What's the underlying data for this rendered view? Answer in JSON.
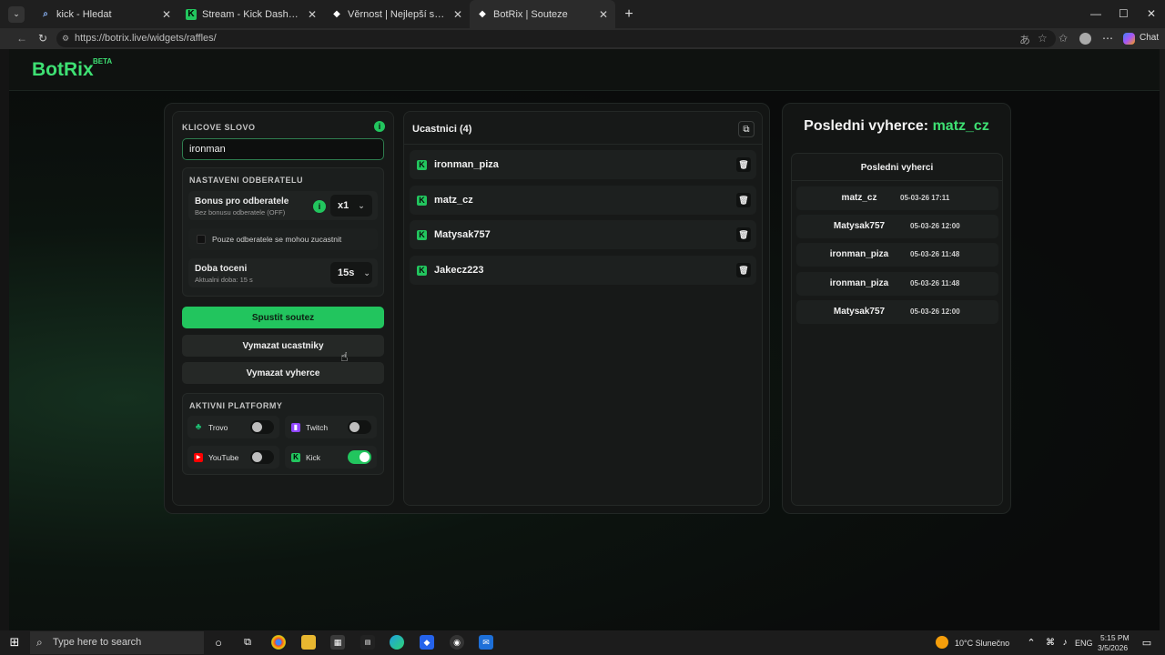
{
  "browser": {
    "tabs": [
      {
        "label": "kick - Hledat",
        "icon": "search-icon"
      },
      {
        "label": "Stream - Kick Dashboard",
        "icon": "kick-icon"
      },
      {
        "label": "Věrnost | Nejlepší software pro vyl",
        "icon": "botrix-icon"
      },
      {
        "label": "BotRix | Souteze",
        "icon": "botrix-icon",
        "active": true
      }
    ],
    "url": "https://botrix.live/widgets/raffles/",
    "chat_label": "Chat"
  },
  "header": {
    "logo": "BotRix",
    "logo_badge": "BETA"
  },
  "raffle": {
    "keyword_label": "KLICOVE SLOVO",
    "keyword_value": "ironman",
    "subscriber_section_label": "NASTAVENI ODBERATELU",
    "bonus_title": "Bonus pro odberatele",
    "bonus_sub": "Bez bonusu odberatele (OFF)",
    "bonus_value": "x1",
    "subs_only_label": "Pouze odberatele se mohou zucastnit",
    "spin_title": "Doba toceni",
    "spin_sub": "Aktualni doba: 15 s",
    "spin_value": "15s",
    "start_button": "Spustit soutez",
    "clear_participants_button": "Vymazat ucastniky",
    "clear_winners_button": "Vymazat vyherce",
    "platforms_label": "AKTIVNI PLATFORMY",
    "platforms": [
      {
        "name": "Trovo",
        "enabled": false,
        "icon": "trovo-icon",
        "color": "#1dbf73"
      },
      {
        "name": "Twitch",
        "enabled": false,
        "icon": "twitch-icon",
        "color": "#9146ff"
      },
      {
        "name": "YouTube",
        "enabled": false,
        "icon": "youtube-icon",
        "color": "#ff0000"
      },
      {
        "name": "Kick",
        "enabled": true,
        "icon": "kick-icon",
        "color": "#22c55e"
      }
    ]
  },
  "participants": {
    "title": "Ucastnici (4)",
    "items": [
      "ironman_piza",
      "matz_cz",
      "Matysak757",
      "Jakecz223"
    ]
  },
  "winners": {
    "last_winner_label": "Posledni vyherce:",
    "last_winner_name": "matz_cz",
    "list_title": "Posledni vyherci",
    "items": [
      {
        "name": "matz_cz",
        "time": "05-03-26 17:11"
      },
      {
        "name": "Matysak757",
        "time": "05-03-26 12:00"
      },
      {
        "name": "ironman_piza",
        "time": "05-03-26 11:48"
      },
      {
        "name": "ironman_piza",
        "time": "05-03-26 11:48"
      },
      {
        "name": "Matysak757",
        "time": "05-03-26 12:00"
      }
    ]
  },
  "taskbar": {
    "search_placeholder": "Type here to search",
    "weather": "10°C  Slunečno",
    "language": "ENG",
    "time": "5:15 PM",
    "date": "3/5/2026"
  },
  "colors": {
    "accent": "#22c55e",
    "background": "#0b0d0c"
  }
}
